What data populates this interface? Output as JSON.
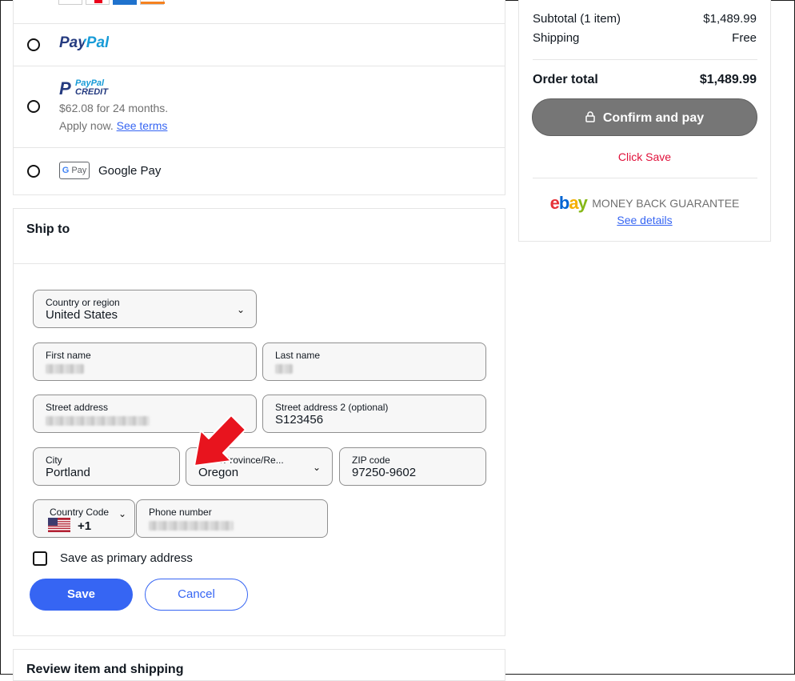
{
  "payment": {
    "paypal": {
      "logo": "PayPal"
    },
    "paypal_credit": {
      "logo_line1": "PayPal",
      "logo_line2": "CREDIT",
      "offer": "$62.08 for 24 months.",
      "apply_text": "Apply now.",
      "terms_link": "See terms"
    },
    "google_pay": {
      "badge_g": "G",
      "badge_pay": "Pay",
      "label": "Google Pay"
    }
  },
  "ship_to": {
    "title": "Ship to",
    "country": {
      "label": "Country or region",
      "value": "United States"
    },
    "first_name": {
      "label": "First name",
      "value": ""
    },
    "last_name": {
      "label": "Last name",
      "value": ""
    },
    "street": {
      "label": "Street address",
      "value": ""
    },
    "street2": {
      "label": "Street address 2 (optional)",
      "value": "S123456"
    },
    "city": {
      "label": "City",
      "value": "Portland"
    },
    "state": {
      "label": "State/Province/Re...",
      "value": "Oregon"
    },
    "zip": {
      "label": "ZIP code",
      "value": "97250-9602"
    },
    "country_code": {
      "label": "Country Code",
      "value": "+1"
    },
    "phone": {
      "label": "Phone number",
      "value": ""
    },
    "save_primary": "Save as primary address",
    "save_button": "Save",
    "cancel_button": "Cancel"
  },
  "review": {
    "title": "Review item and shipping"
  },
  "summary": {
    "subtotal_label": "Subtotal (1 item)",
    "subtotal_value": "$1,489.99",
    "shipping_label": "Shipping",
    "shipping_value": "Free",
    "total_label": "Order total",
    "total_value": "$1,489.99",
    "confirm_button": "Confirm and pay",
    "click_save": "Click Save",
    "guarantee_text": "MONEY BACK GUARANTEE",
    "see_details": "See details"
  },
  "colors": {
    "ebay_e": "#e53238",
    "ebay_b": "#0064d2",
    "ebay_a": "#f5af02",
    "ebay_y": "#86b817",
    "primary_blue": "#3665f3",
    "warning_red": "#e0103a",
    "disabled_gray": "#767676"
  }
}
